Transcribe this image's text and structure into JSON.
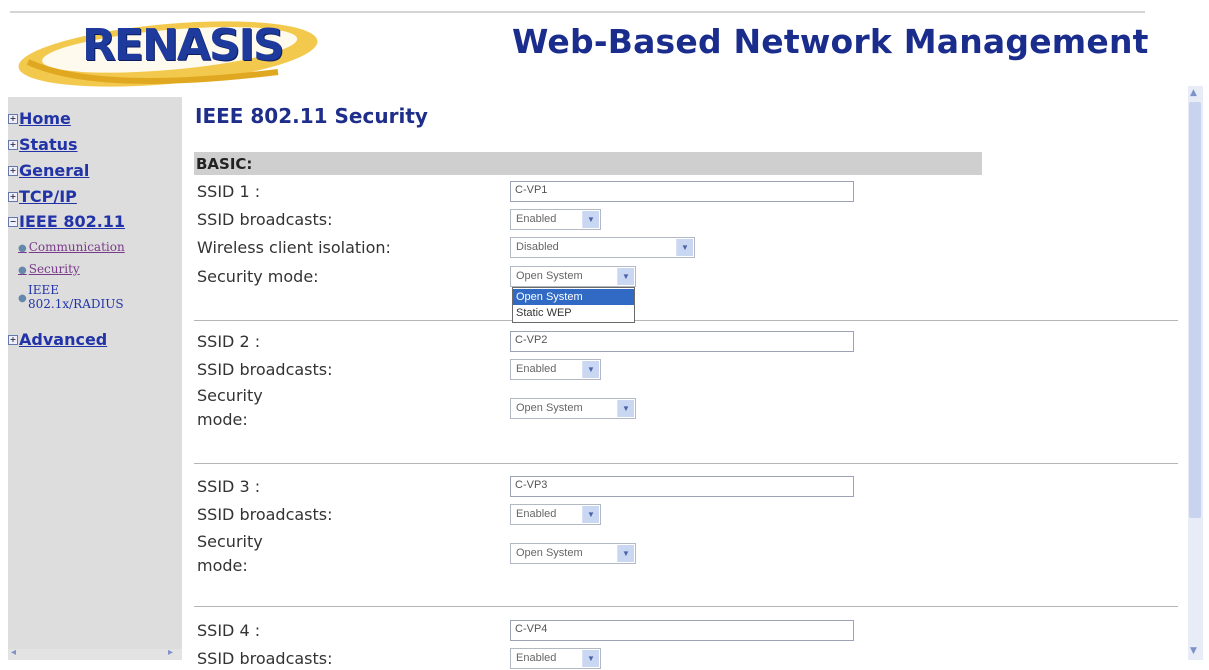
{
  "header": {
    "logo_text": "RENASIS",
    "title": "Web-Based Network Management"
  },
  "sidebar": {
    "items": [
      {
        "label": "Home",
        "expander": "+"
      },
      {
        "label": "Status",
        "expander": "+"
      },
      {
        "label": "General",
        "expander": "+"
      },
      {
        "label": "TCP/IP",
        "expander": "+"
      },
      {
        "label": "IEEE 802.11",
        "expander": "−"
      }
    ],
    "subitems": [
      {
        "label": "Communication"
      },
      {
        "label": "Security"
      },
      {
        "label_line1": "IEEE",
        "label_line2": "802.1x/RADIUS"
      }
    ],
    "advanced": {
      "label": "Advanced",
      "expander": "+"
    }
  },
  "main": {
    "title": "IEEE 802.11 Security",
    "section_header": "BASIC:",
    "ssid1": {
      "ssid_label": "SSID 1 :",
      "ssid_value": "C-VP1",
      "broadcast_label": "SSID broadcasts:",
      "broadcast_value": "Enabled",
      "isolation_label": "Wireless client isolation:",
      "isolation_value": "Disabled",
      "security_label": "Security mode:",
      "security_value": "Open System",
      "security_options": [
        "Open System",
        "Static WEP"
      ]
    },
    "ssid2": {
      "ssid_label": "SSID 2 :",
      "ssid_value": "C-VP2",
      "broadcast_label": "SSID broadcasts:",
      "broadcast_value": "Enabled",
      "security_label_line1": "Security",
      "security_label_line2": "mode:",
      "security_value": "Open System"
    },
    "ssid3": {
      "ssid_label": "SSID 3 :",
      "ssid_value": "C-VP3",
      "broadcast_label": "SSID broadcasts:",
      "broadcast_value": "Enabled",
      "security_label_line1": "Security",
      "security_label_line2": "mode:",
      "security_value": "Open System"
    },
    "ssid4": {
      "ssid_label": "SSID 4 :",
      "ssid_value": "C-VP4",
      "broadcast_label": "SSID broadcasts:",
      "broadcast_value": "Enabled"
    }
  },
  "colors": {
    "brand_blue": "#1a2d8c",
    "sidebar_bg": "#dddddd",
    "section_bar": "#cfcfcf",
    "selection": "#316ac5"
  },
  "icons": [
    "expand-box-icon",
    "collapse-box-icon",
    "bullet-icon",
    "dropdown-arrow-icon",
    "scroll-arrow-icon"
  ]
}
